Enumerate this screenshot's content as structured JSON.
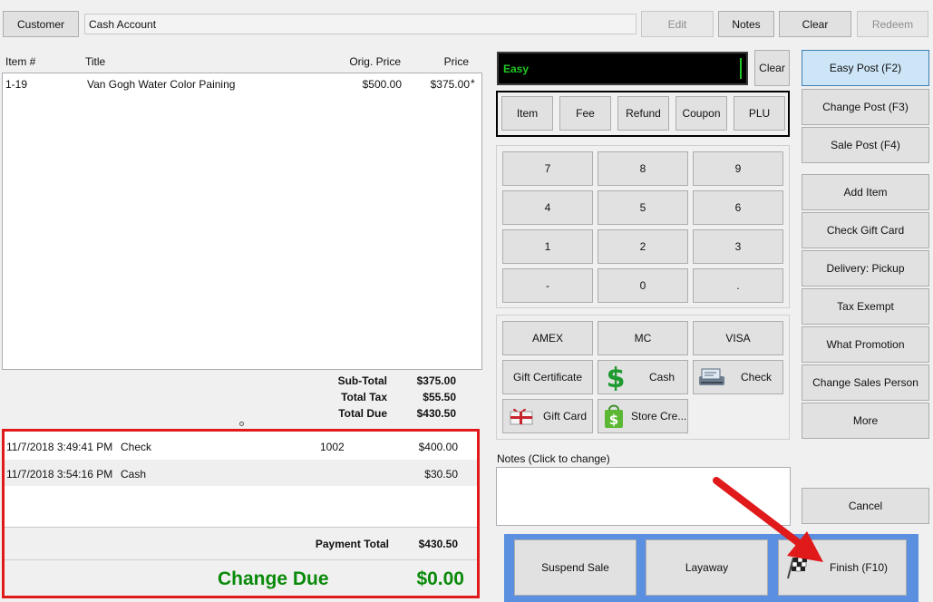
{
  "top_bar": {
    "customer_label": "Customer",
    "customer_value": "Cash Account",
    "edit_label": "Edit",
    "notes_label": "Notes",
    "clear_label": "Clear",
    "redeem_label": "Redeem"
  },
  "items_table": {
    "headers": [
      "Item #",
      "Title",
      "Orig. Price",
      "Price"
    ],
    "rows": [
      {
        "item": "1-19",
        "title": "Van Gogh Water Color Paining",
        "orig_price": "$500.00",
        "price": "$375.00",
        "flag": "*"
      }
    ]
  },
  "totals": {
    "subtotal_label": "Sub-Total",
    "subtotal_value": "$375.00",
    "tax_label": "Total Tax",
    "tax_value": "$55.50",
    "due_label": "Total Due",
    "due_value": "$430.50"
  },
  "payments": {
    "rows": [
      {
        "datetime": "11/7/2018 3:49:41 PM",
        "method": "Check",
        "ref": "1002",
        "amount": "$400.00"
      },
      {
        "datetime": "11/7/2018 3:54:16 PM",
        "method": "Cash",
        "ref": "",
        "amount": "$30.50"
      }
    ],
    "total_label": "Payment Total",
    "total_value": "$430.50",
    "change_label": "Change Due",
    "change_value": "$0.00"
  },
  "entry": {
    "mode_text": "Easy",
    "clear_label": "Clear",
    "type_buttons": [
      "Item",
      "Fee",
      "Refund",
      "Coupon",
      "PLU"
    ]
  },
  "keypad": [
    "7",
    "8",
    "9",
    "4",
    "5",
    "6",
    "1",
    "2",
    "3",
    "-",
    "0",
    "."
  ],
  "tenders": {
    "amex": "AMEX",
    "mc": "MC",
    "visa": "VISA",
    "gift_certificate": "Gift Certificate",
    "cash": "Cash",
    "check": "Check",
    "gift_card": "Gift Card",
    "store_credit": "Store Cre..."
  },
  "notes": {
    "label": "Notes (Click to change)",
    "value": ""
  },
  "right_panel": {
    "easy_post": "Easy Post (F2)",
    "change_post": "Change Post (F3)",
    "sale_post": "Sale Post (F4)",
    "add_item": "Add Item",
    "check_gift_card": "Check Gift Card",
    "delivery": "Delivery: Pickup",
    "tax_exempt": "Tax Exempt",
    "what_promotion": "What Promotion",
    "change_sales_person": "Change Sales Person",
    "more": "More",
    "cancel": "Cancel"
  },
  "bottom_actions": {
    "suspend": "Suspend Sale",
    "layaway": "Layaway",
    "finish": "Finish (F10)"
  },
  "colors": {
    "highlight_red": "#e0191b",
    "change_due_green": "#0a8a0a",
    "finish_panel_blue": "#5b8fe0",
    "entry_display_bg": "#000000",
    "entry_text_green": "#22c622"
  }
}
